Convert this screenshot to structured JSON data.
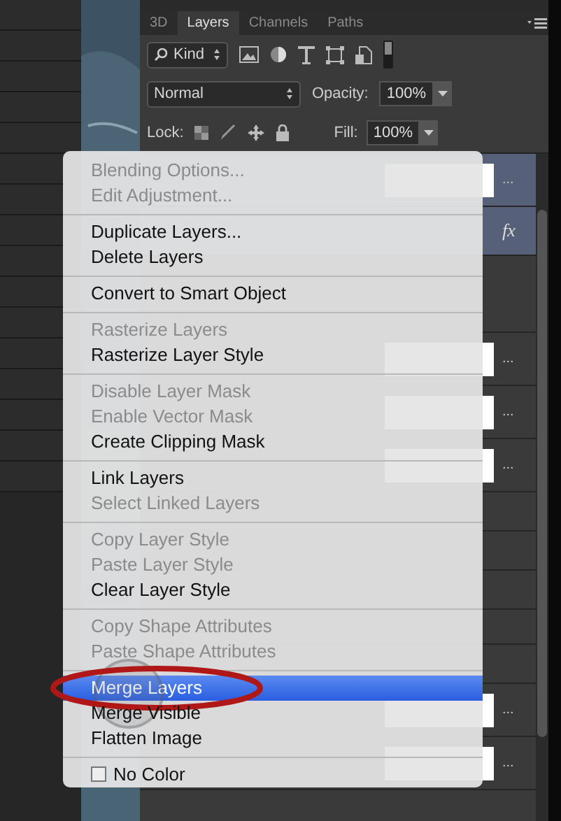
{
  "tabs": [
    {
      "label": "3D",
      "selected": false
    },
    {
      "label": "Layers",
      "selected": true
    },
    {
      "label": "Channels",
      "selected": false
    },
    {
      "label": "Paths",
      "selected": false
    }
  ],
  "filter": {
    "value": "Kind"
  },
  "blend_mode": "Normal",
  "opacity": {
    "label": "Opacity:",
    "value": "100%"
  },
  "lock_label": "Lock:",
  "fill": {
    "label": "Fill:",
    "value": "100%"
  },
  "layers": [
    {
      "kind": "adjustment",
      "selected": true,
      "more": "..."
    },
    {
      "kind": "fx",
      "selected": true,
      "badge": "fx"
    },
    {
      "kind": "effects",
      "selected": false
    },
    {
      "kind": "adjustment",
      "selected": false,
      "more": "..."
    },
    {
      "kind": "adjustment",
      "selected": false,
      "more": "..."
    },
    {
      "kind": "adjustment",
      "selected": false,
      "more": "..."
    },
    {
      "kind": "pixel",
      "selected": false
    },
    {
      "kind": "pixel",
      "selected": false
    },
    {
      "kind": "pixel",
      "selected": false
    },
    {
      "kind": "group",
      "selected": false
    },
    {
      "kind": "pixel",
      "selected": false
    },
    {
      "kind": "adjustment",
      "selected": false,
      "more": "..."
    },
    {
      "kind": "adjustment",
      "selected": false,
      "more": "..."
    }
  ],
  "menu": {
    "groups": [
      [
        {
          "label": "Blending Options...",
          "disabled": true,
          "selected": false
        },
        {
          "label": "Edit Adjustment...",
          "disabled": true,
          "selected": false
        }
      ],
      [
        {
          "label": "Duplicate Layers...",
          "disabled": false,
          "selected": false
        },
        {
          "label": "Delete Layers",
          "disabled": false,
          "selected": false
        }
      ],
      [
        {
          "label": "Convert to Smart Object",
          "disabled": false,
          "selected": false
        }
      ],
      [
        {
          "label": "Rasterize Layers",
          "disabled": true,
          "selected": false
        },
        {
          "label": "Rasterize Layer Style",
          "disabled": false,
          "selected": false
        }
      ],
      [
        {
          "label": "Disable Layer Mask",
          "disabled": true,
          "selected": false
        },
        {
          "label": "Enable Vector Mask",
          "disabled": true,
          "selected": false
        },
        {
          "label": "Create Clipping Mask",
          "disabled": false,
          "selected": false
        }
      ],
      [
        {
          "label": "Link Layers",
          "disabled": false,
          "selected": false
        },
        {
          "label": "Select Linked Layers",
          "disabled": true,
          "selected": false
        }
      ],
      [
        {
          "label": "Copy Layer Style",
          "disabled": true,
          "selected": false
        },
        {
          "label": "Paste Layer Style",
          "disabled": true,
          "selected": false
        },
        {
          "label": "Clear Layer Style",
          "disabled": false,
          "selected": false
        }
      ],
      [
        {
          "label": "Copy Shape Attributes",
          "disabled": true,
          "selected": false
        },
        {
          "label": "Paste Shape Attributes",
          "disabled": true,
          "selected": false
        }
      ],
      [
        {
          "label": "Merge Layers",
          "disabled": false,
          "selected": true
        },
        {
          "label": "Merge Visible",
          "disabled": false,
          "selected": false
        },
        {
          "label": "Flatten Image",
          "disabled": false,
          "selected": false
        }
      ],
      [
        {
          "label": "No Color",
          "disabled": false,
          "selected": false,
          "kind": "swatch"
        }
      ]
    ]
  }
}
